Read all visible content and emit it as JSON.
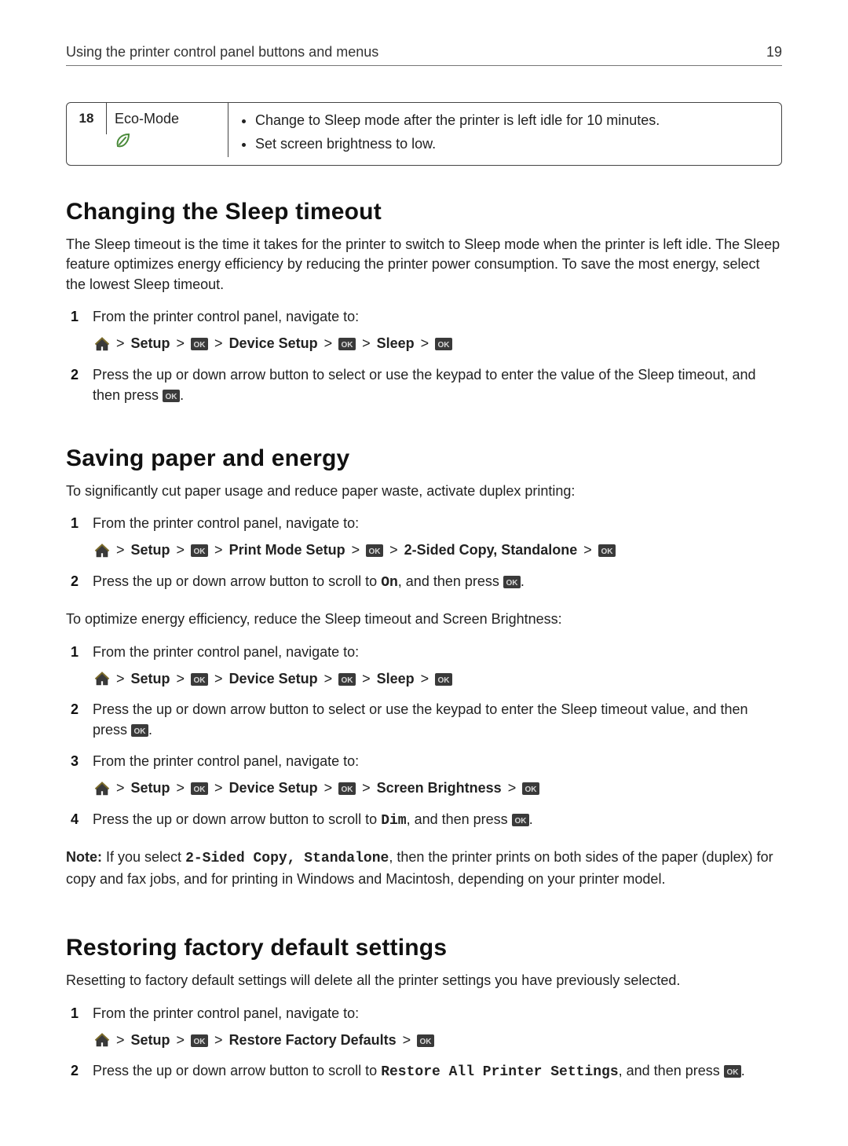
{
  "running_head": {
    "title": "Using the printer control panel buttons and menus",
    "page_number": "19"
  },
  "feature_box": {
    "row_number": "18",
    "label": "Eco-Mode",
    "bullets": [
      "Change to Sleep mode after the printer is left idle for 10 minutes.",
      "Set screen brightness to low."
    ]
  },
  "nav_labels": {
    "setup": "Setup",
    "device_setup": "Device Setup",
    "sleep": "Sleep",
    "print_mode_setup": "Print Mode Setup",
    "two_sided_copy": "2-Sided Copy, Standalone",
    "screen_brightness": "Screen Brightness",
    "restore_defaults": "Restore Factory Defaults",
    "gt": ">"
  },
  "section1": {
    "heading": "Changing the Sleep timeout",
    "intro": "The Sleep timeout is the time it takes for the printer to switch to Sleep mode when the printer is left idle. The Sleep feature optimizes energy efficiency by reducing the printer power consumption. To save the most energy, select the lowest Sleep timeout.",
    "step1": "From the printer control panel, navigate to:",
    "step2_a": "Press the up or down arrow button to select or use the keypad to enter the value of the Sleep timeout, and then press ",
    "step2_b": "."
  },
  "section2": {
    "heading": "Saving paper and energy",
    "intro1": "To significantly cut paper usage and reduce paper waste, activate duplex printing:",
    "listA_step1": "From the printer control panel, navigate to:",
    "listA_step2_a": "Press the up or down arrow button to scroll to ",
    "listA_step2_on": "On",
    "listA_step2_b": ", and then press ",
    "listA_step2_c": ".",
    "intro2": "To optimize energy efficiency, reduce the Sleep timeout and Screen Brightness:",
    "listB_step1": "From the printer control panel, navigate to:",
    "listB_step2_a": "Press the up or down arrow button to select or use the keypad to enter the Sleep timeout value, and then press ",
    "listB_step2_b": ".",
    "listB_step3": "From the printer control panel, navigate to:",
    "listB_step4_a": "Press the up or down arrow button to scroll to ",
    "listB_step4_dim": "Dim",
    "listB_step4_b": ", and then press ",
    "listB_step4_c": ".",
    "note_label": "Note:",
    "note_a": " If you select ",
    "note_mono": "2-Sided Copy, Standalone",
    "note_b": ", then the printer prints on both sides of the paper (duplex) for copy and fax jobs, and for printing in Windows and Macintosh, depending on your printer model."
  },
  "section3": {
    "heading": "Restoring factory default settings",
    "intro": "Resetting to factory default settings will delete all the printer settings you have previously selected.",
    "step1": "From the printer control panel, navigate to:",
    "step2_a": "Press the up or down arrow button to scroll to ",
    "step2_mono": "Restore All Printer Settings",
    "step2_b": ", and then press ",
    "step2_c": "."
  }
}
